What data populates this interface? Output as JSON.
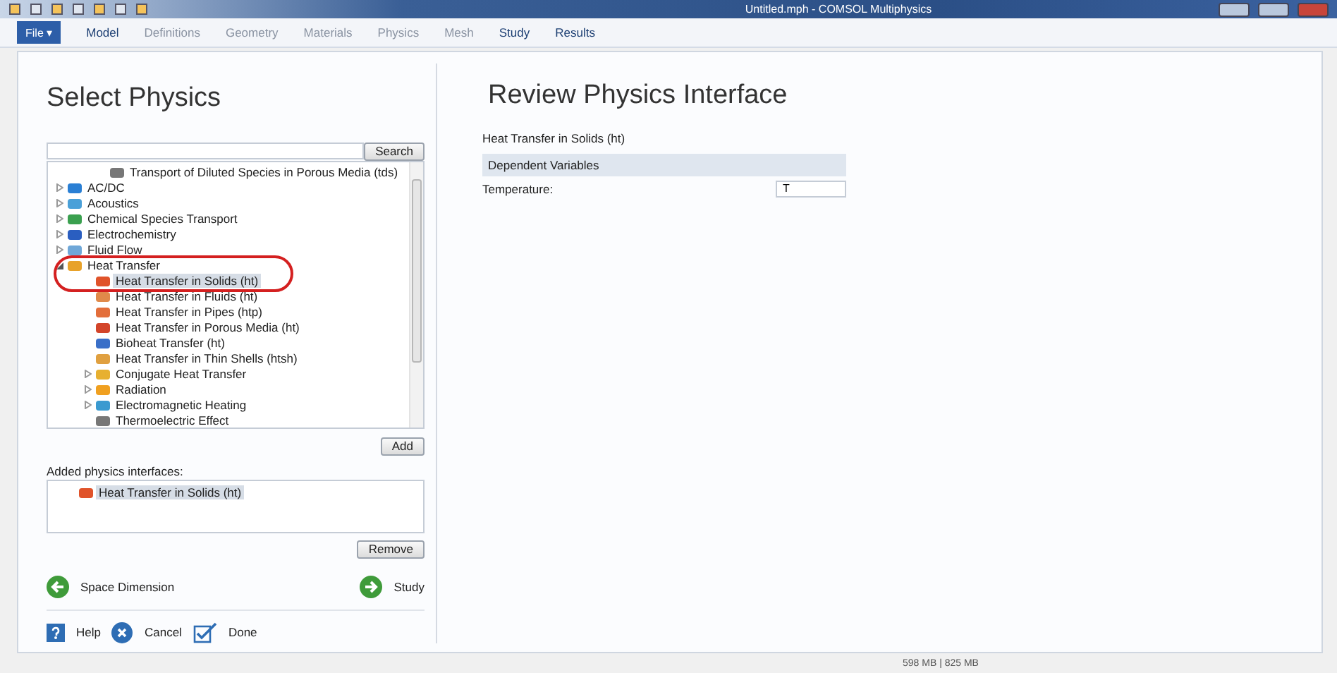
{
  "window": {
    "title": "Untitled.mph - COMSOL Multiphysics"
  },
  "menu": {
    "file": "File ▾",
    "tabs": [
      {
        "label": "Model",
        "disabled": false
      },
      {
        "label": "Definitions",
        "disabled": true
      },
      {
        "label": "Geometry",
        "disabled": true
      },
      {
        "label": "Materials",
        "disabled": true
      },
      {
        "label": "Physics",
        "disabled": true
      },
      {
        "label": "Mesh",
        "disabled": true
      },
      {
        "label": "Study",
        "disabled": false
      },
      {
        "label": "Results",
        "disabled": false
      }
    ]
  },
  "select_physics": {
    "title": "Select Physics",
    "search_button": "Search",
    "tree_top": {
      "label": "Transport of Diluted Species in Porous Media (tds)"
    },
    "tree": [
      {
        "label": "AC/DC",
        "kind": "branch",
        "expanded": false,
        "selected": false
      },
      {
        "label": "Acoustics",
        "kind": "branch",
        "expanded": false,
        "selected": false
      },
      {
        "label": "Chemical Species Transport",
        "kind": "branch",
        "expanded": false,
        "selected": false
      },
      {
        "label": "Electrochemistry",
        "kind": "branch",
        "expanded": false,
        "selected": false
      },
      {
        "label": "Fluid Flow",
        "kind": "branch",
        "expanded": false,
        "selected": false
      },
      {
        "label": "Heat Transfer",
        "kind": "branch",
        "expanded": true,
        "selected": false,
        "children": [
          {
            "label": "Heat Transfer in Solids (ht)",
            "kind": "leaf",
            "selected": true
          },
          {
            "label": "Heat Transfer in Fluids (ht)",
            "kind": "leaf",
            "selected": false
          },
          {
            "label": "Heat Transfer in Pipes (htp)",
            "kind": "leaf",
            "selected": false
          },
          {
            "label": "Heat Transfer in Porous Media (ht)",
            "kind": "leaf",
            "selected": false
          },
          {
            "label": "Bioheat Transfer (ht)",
            "kind": "leaf",
            "selected": false
          },
          {
            "label": "Heat Transfer in Thin Shells (htsh)",
            "kind": "leaf",
            "selected": false
          },
          {
            "label": "Conjugate Heat Transfer",
            "kind": "branch",
            "expanded": false,
            "selected": false
          },
          {
            "label": "Radiation",
            "kind": "branch",
            "expanded": false,
            "selected": false
          },
          {
            "label": "Electromagnetic Heating",
            "kind": "branch",
            "expanded": false,
            "selected": false
          },
          {
            "label": "Thermoelectric Effect",
            "kind": "leaf",
            "selected": false
          }
        ]
      }
    ],
    "add_button": "Add",
    "added_label": "Added physics interfaces:",
    "added": [
      {
        "label": "Heat Transfer in Solids (ht)",
        "selected": true
      }
    ],
    "remove_button": "Remove",
    "back": "Space Dimension",
    "next": "Study",
    "footer": [
      {
        "label": "Help",
        "kind": "help"
      },
      {
        "label": "Cancel",
        "kind": "cancel"
      },
      {
        "label": "Done",
        "kind": "done"
      }
    ]
  },
  "review": {
    "title": "Review Physics Interface",
    "interface": "Heat Transfer in Solids (ht)",
    "section": "Dependent Variables",
    "fields": [
      {
        "label": "Temperature:",
        "value": "T"
      }
    ]
  },
  "status_bar": {
    "memory": "598 MB | 825 MB"
  }
}
